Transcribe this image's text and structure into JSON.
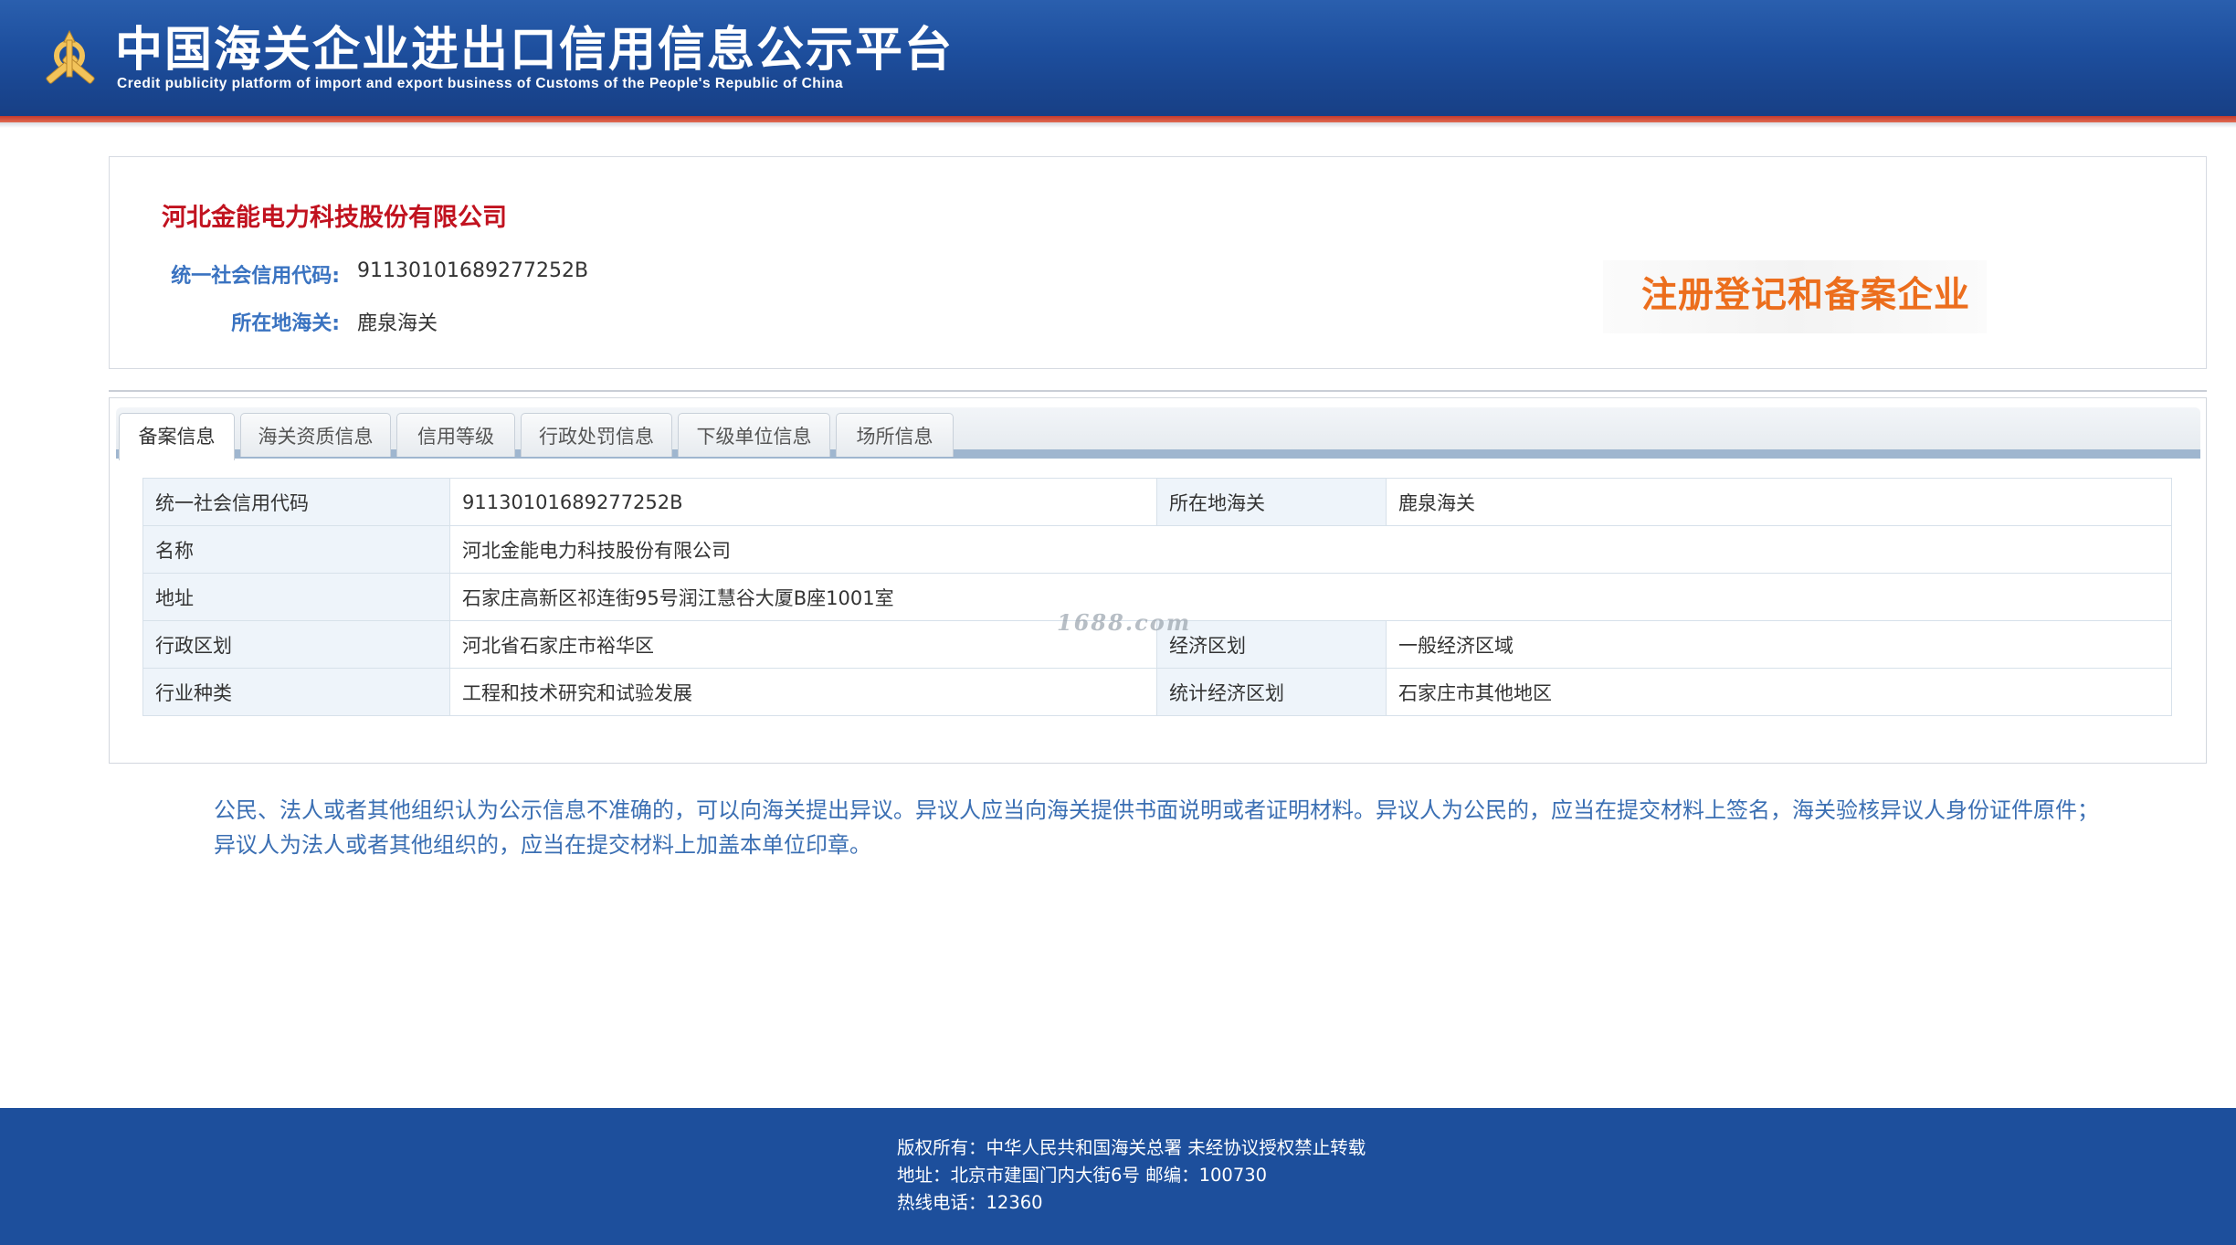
{
  "header": {
    "title": "中国海关企业进出口信用信息公示平台",
    "subtitle": "Credit publicity platform of import and export business of Customs of the People's Republic of China",
    "logo_icon": "customs-emblem-icon"
  },
  "company": {
    "name": "河北金能电力科技股份有限公司",
    "credit_code_label": "统一社会信用代码:",
    "credit_code": "91130101689277252B",
    "customs_label": "所在地海关:",
    "customs": "鹿泉海关",
    "status_stamp": "注册登记和备案企业"
  },
  "tabs": [
    {
      "label": "备案信息",
      "active": true
    },
    {
      "label": "海关资质信息",
      "active": false
    },
    {
      "label": "信用等级",
      "active": false
    },
    {
      "label": "行政处罚信息",
      "active": false
    },
    {
      "label": "下级单位信息",
      "active": false
    },
    {
      "label": "场所信息",
      "active": false
    }
  ],
  "info_table": {
    "credit_code_label": "统一社会信用代码",
    "credit_code": "91130101689277252B",
    "customs_label": "所在地海关",
    "customs": "鹿泉海关",
    "name_label": "名称",
    "name": "河北金能电力科技股份有限公司",
    "address_label": "地址",
    "address": "石家庄高新区祁连街95号润江慧谷大厦B座1001室",
    "admin_region_label": "行政区划",
    "admin_region": "河北省石家庄市裕华区",
    "economic_zone_label": "经济区划",
    "economic_zone": "一般经济区域",
    "industry_label": "行业种类",
    "industry": "工程和技术研究和试验发展",
    "stat_zone_label": "统计经济区划",
    "stat_zone": "石家庄市其他地区"
  },
  "watermark": "1688.com",
  "notice": "公民、法人或者其他组织认为公示信息不准确的，可以向海关提出异议。异议人应当向海关提供书面说明或者证明材料。异议人为公民的，应当在提交材料上签名，海关验核异议人身份证件原件；异议人为法人或者其他组织的，应当在提交材料上加盖本单位印章。",
  "footer": {
    "copyright": "版权所有：中华人民共和国海关总署    未经协议授权禁止转载",
    "address": "地址：北京市建国门内大街6号 邮编：100730",
    "hotline": "热线电话：12360"
  },
  "colors": {
    "header_blue": "#1d4e9d",
    "accent_red": "#c43a2c",
    "company_name_red": "#c1121f",
    "label_blue": "#3a73c1",
    "stamp_orange": "#ec6e1d",
    "footer_blue": "#1d4f9c"
  }
}
